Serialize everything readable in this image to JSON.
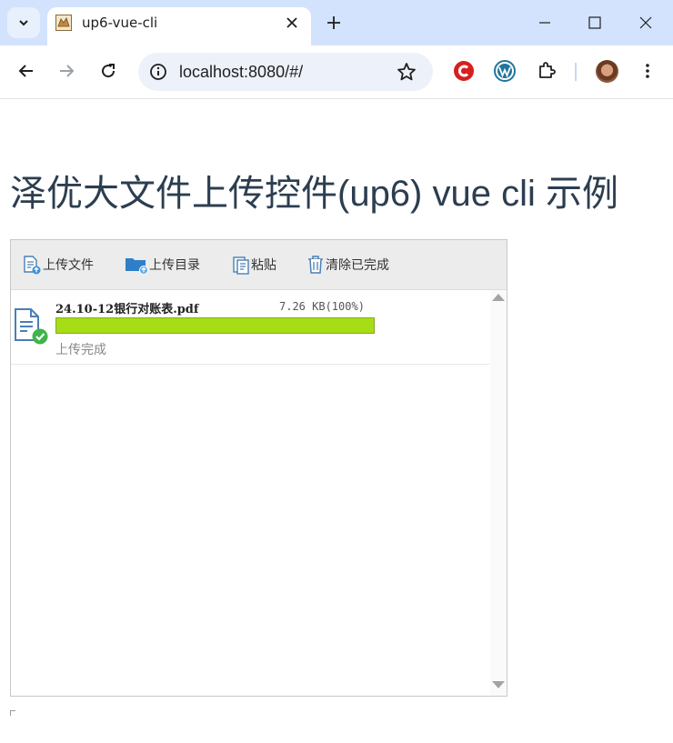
{
  "browser": {
    "tab_title": "up6-vue-cli",
    "url": "localhost:8080/#/"
  },
  "page": {
    "heading": "泽优大文件上传控件(up6) vue cli 示例"
  },
  "uploader": {
    "toolbar": {
      "upload_file": "上传文件",
      "upload_folder": "上传目录",
      "paste": "粘贴",
      "clear_completed": "清除已完成"
    },
    "files": [
      {
        "name": "24.10-12银行对账表.pdf",
        "size_progress": "7.26 KB(100%)",
        "progress": 1.0,
        "status": "上传完成"
      }
    ]
  },
  "colors": {
    "progress_fill": "#a6dd16",
    "heading": "#2c3e50",
    "tab_strip": "#d3e3fd"
  },
  "icons": {
    "extension_1": "red-c-extension-icon",
    "extension_2": "wordpress-icon",
    "extension_3": "puzzle-extensions-icon"
  }
}
